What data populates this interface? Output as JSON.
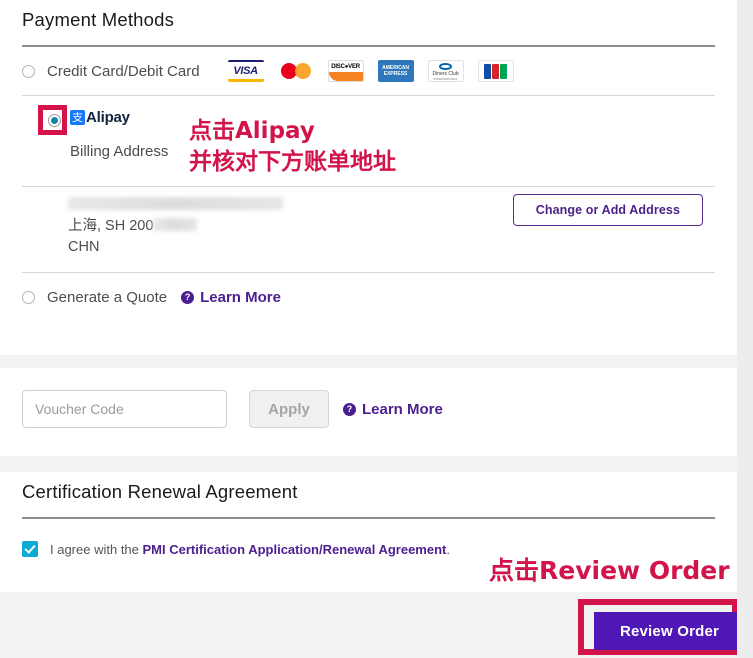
{
  "payment_section": {
    "title": "Payment Methods",
    "credit_card": {
      "label": "Credit Card/Debit Card",
      "selected": false,
      "card_logos": [
        "VISA",
        "Mastercard",
        "DISCOVER",
        "AMERICAN EXPRESS",
        "Diners Club INTERNATIONAL",
        "JCB"
      ]
    },
    "alipay": {
      "label": "Alipay",
      "mark_glyph": "支",
      "selected": true,
      "billing_address_label": "Billing Address",
      "address": {
        "line1_redacted": true,
        "line2_prefix": "上海, SH 200",
        "line2_redacted": true,
        "line3": "CHN"
      },
      "change_address_button": "Change or Add Address"
    },
    "generate_quote": {
      "label": "Generate a Quote",
      "selected": false,
      "learn_more": "Learn More",
      "help_glyph": "?"
    }
  },
  "voucher_section": {
    "input_placeholder": "Voucher Code",
    "input_value": "",
    "apply_button": "Apply",
    "learn_more": "Learn More",
    "help_glyph": "?"
  },
  "agreement_section": {
    "title": "Certification Renewal Agreement",
    "checkbox_checked": true,
    "agree_prefix": "I agree with the ",
    "agree_link": "PMI Certification Application/Renewal Agreement",
    "agree_suffix": "."
  },
  "actions": {
    "review_order_button": "Review Order"
  },
  "annotations": {
    "alipay_line1": "点击Alipay",
    "alipay_line2": "并核对下方账单地址",
    "review_order": "点击Review Order"
  },
  "colors": {
    "annotation_red": "#d3144a",
    "purple_accent": "#4b1f8f",
    "review_button": "#4f17b3",
    "checkbox_teal": "#0caad4"
  }
}
